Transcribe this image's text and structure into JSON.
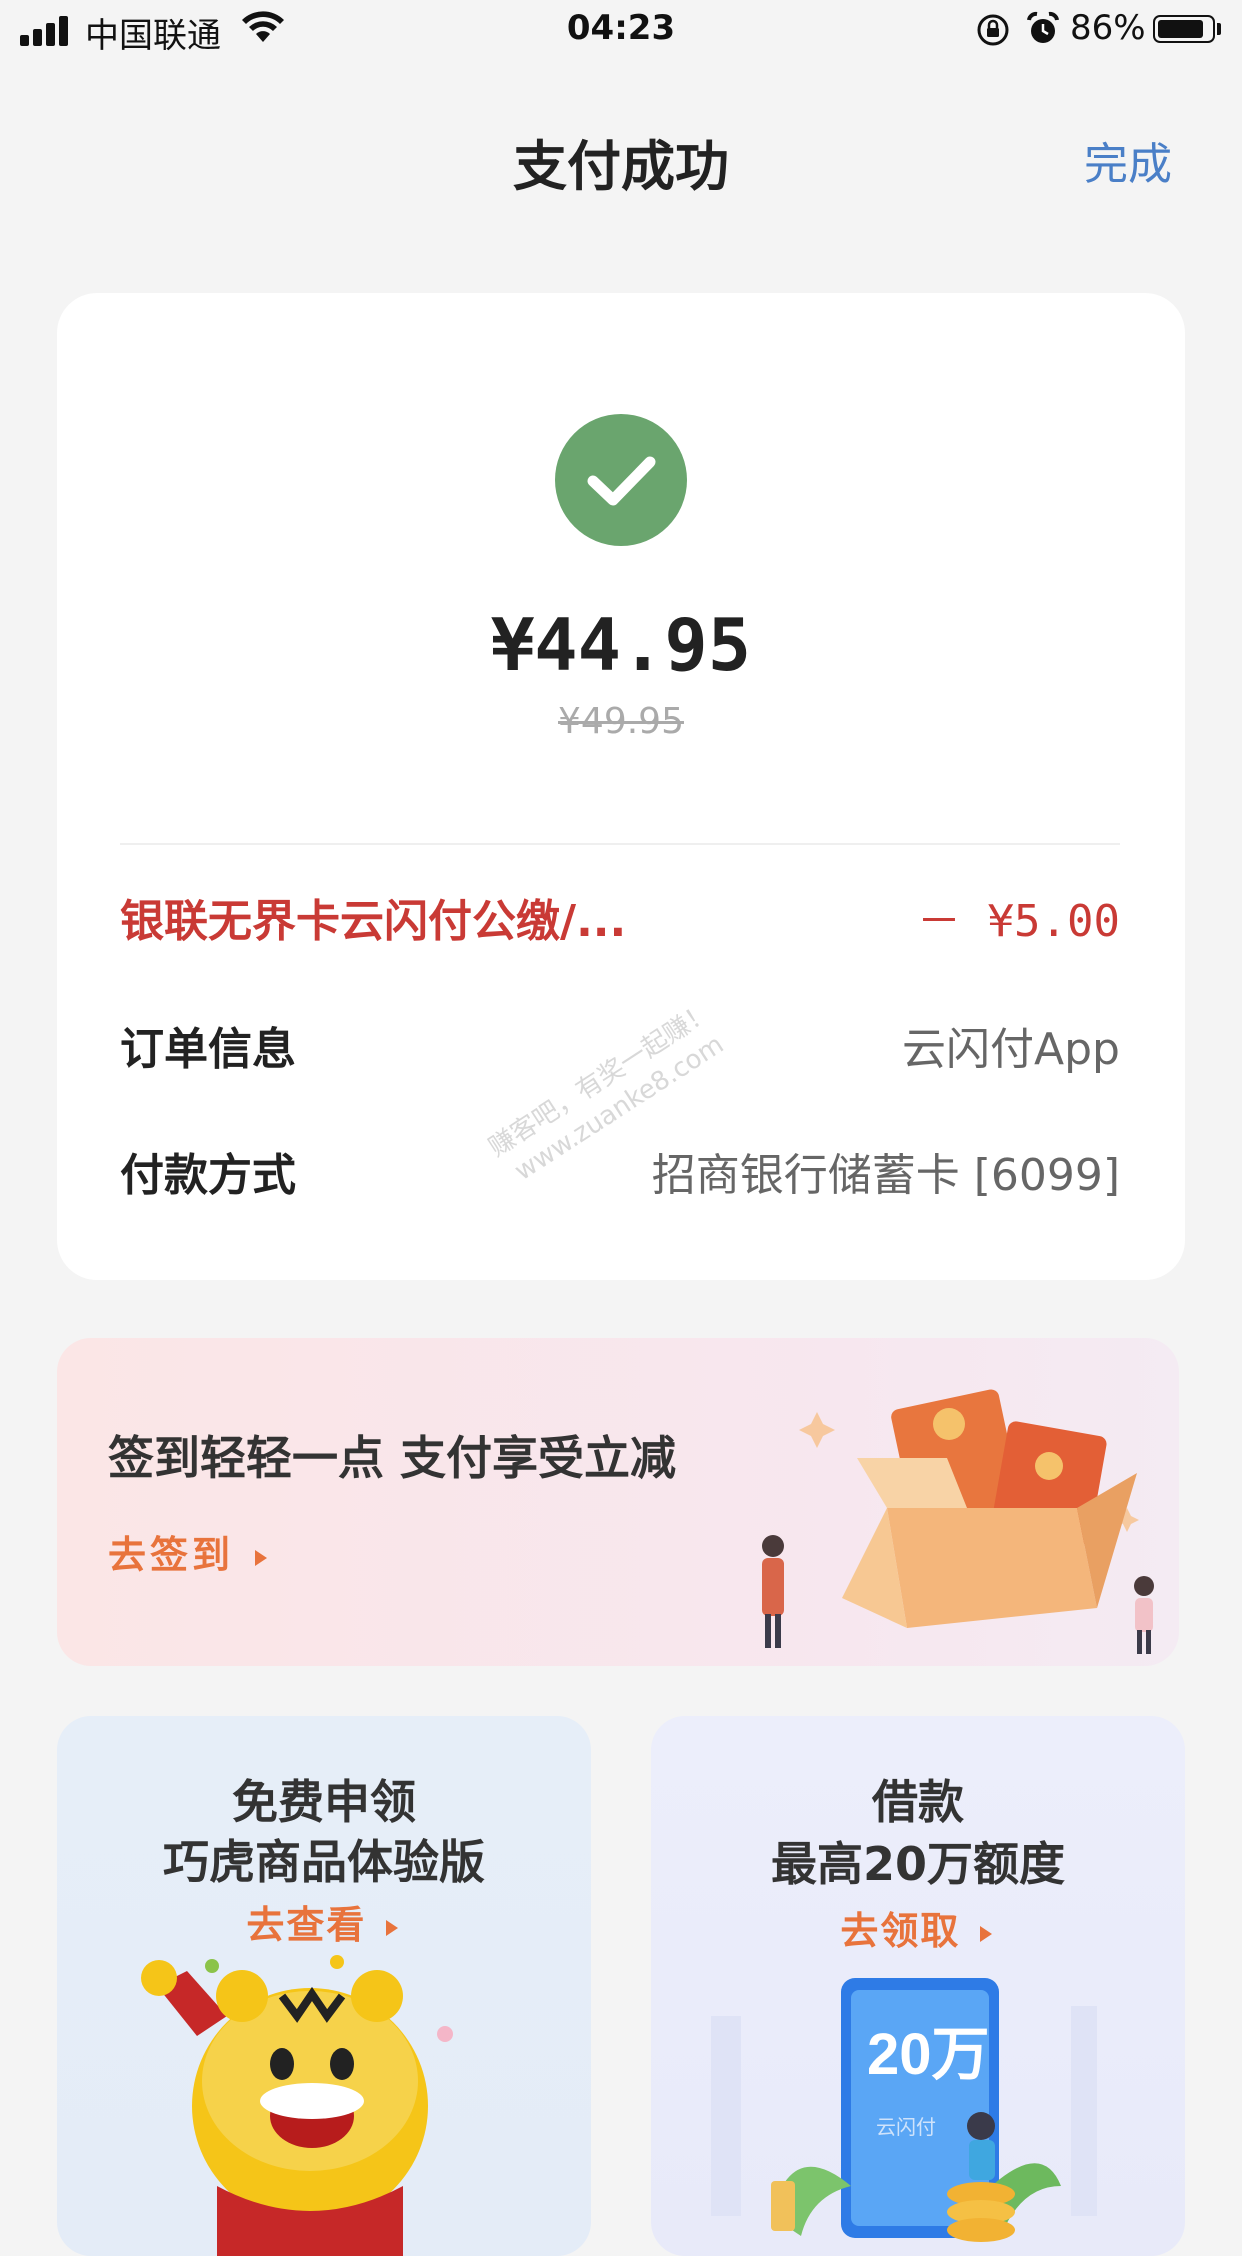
{
  "status_bar": {
    "carrier": "中国联通",
    "time": "04:23",
    "battery_percent": "86%",
    "battery_level": 0.86
  },
  "nav": {
    "title": "支付成功",
    "done_label": "完成"
  },
  "payment": {
    "amount": "¥44.95",
    "original_amount": "¥49.95",
    "discount_label": "银联无界卡云闪付公缴/...",
    "discount_value": "－ ¥5.00",
    "rows": [
      {
        "label": "订单信息",
        "value": "云闪付App"
      },
      {
        "label": "付款方式",
        "value": "招商银行储蓄卡 [6099]"
      }
    ]
  },
  "watermark": {
    "line1": "赚客吧，有奖一起赚！",
    "line2": "www.zuanke8.com"
  },
  "sign_banner": {
    "title": "签到轻轻一点 支付享受立减",
    "link": "去签到"
  },
  "promos": [
    {
      "line1": "免费申领",
      "line2": "巧虎商品体验版",
      "link": "去查看"
    },
    {
      "line1": "借款",
      "line2": "最高20万额度",
      "link": "去领取",
      "badge": "20万",
      "brand": "云闪付"
    }
  ],
  "colors": {
    "accent_blue": "#4a7fc7",
    "success_green": "#6aa56e",
    "discount_red": "#c93a35",
    "link_orange": "#e8733c"
  }
}
